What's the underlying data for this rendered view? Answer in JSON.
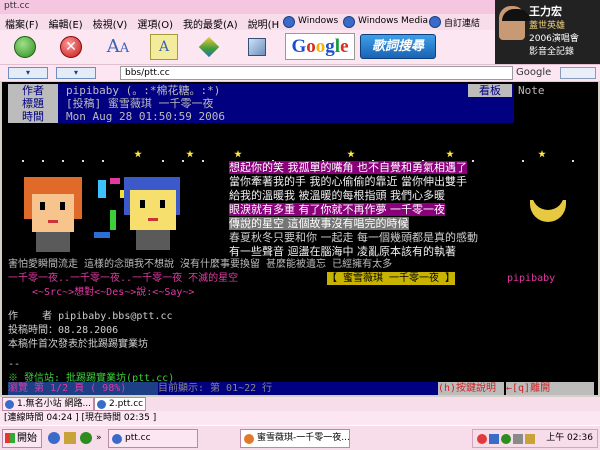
{
  "window": {
    "title": "ptt.cc"
  },
  "menu": [
    "檔案(F)",
    "編輯(E)",
    "檢視(V)",
    "選項(O)",
    "我的最愛(A)",
    "說明(H)"
  ],
  "links": [
    "Windows",
    "Windows Media",
    "自訂連結"
  ],
  "ad": {
    "line1": "王力宏",
    "line2": "蓋世英雄",
    "line3": "2006演唱會",
    "line4": "影音全記錄"
  },
  "toolbar": {
    "google_label": "Google",
    "lyric_label": "歌詞搜尋",
    "font_label": "A"
  },
  "address": {
    "value": "bbs/ptt.cc",
    "google_label": "Google"
  },
  "post": {
    "header": [
      {
        "key": "作者",
        "value": "pipibaby (。:*棉花糖。:*)"
      },
      {
        "key": "標題",
        "value": "[投稿] 蜜雪薇琪 一千零一夜"
      },
      {
        "key": "時間",
        "value": "Mon Aug 28 01:50:59 2006"
      }
    ],
    "board_key": "看板",
    "board_value": "Note",
    "lyrics": [
      "想起你的笑 我孤單的嘴角 也不自覺和勇氣相遇了",
      "當你牽著我的手 我的心偷偷的靠近 當你伸出雙手",
      "給我的溫暖我 被溫暖的每根指頭 我們心多暖",
      "眼淚就有多重 有了你就不再作夢 一千零一夜",
      "傳說的星空 這個故事沒有唱完的時候",
      "春夏秋冬只要和你 一起走 每一個幾頭都是真的感動",
      "有一些聲音 迴盪在腦海中 凌亂原本該有的執著"
    ],
    "lyric8": "害怕愛瞬間流走 這樣的念頭我不想說 沒有什麼事要換留 甚麼能被遺忘 已經擁有太多",
    "credit_line": "一千零一夜..一千零一夜..一千零一夜 不滅的星空",
    "credit_tag": "【 蜜雪薇琪 一千零一夜 】",
    "credit_author": "pipibaby",
    "src_line": "<~Src~>想對<~Des~>說:<~Say~>",
    "author_line": "作    者 pipibaby.bbs@ptt.cc",
    "date_line": "投稿時間：08.28.2006",
    "note_line": "本稿件首次發表於批踢踢實業坊",
    "sep": "--",
    "origin": "※ 發信站: 批踢踢實業坊(ptt.cc)",
    "footer_left": "瀏覽 第 1/2 頁 ( 98%)",
    "footer_mid": "目前顯示: 第 01~22 行",
    "footer_help": "(h)按鍵說明",
    "footer_leave": "←[q]離開"
  },
  "tabs": [
    "1.無名小站 網路...",
    "2.ptt.cc"
  ],
  "connection": "[連線時間 04:24 ] [現在時間 02:35 ]",
  "taskbar": {
    "start": "開始",
    "items": [
      "ptt.cc",
      "蜜雪薇琪-一千零一夜..."
    ],
    "clock": "上午 02:36"
  },
  "colors": {
    "pink": "#f4c6df",
    "navy": "#000080",
    "terminal": "#000000"
  }
}
